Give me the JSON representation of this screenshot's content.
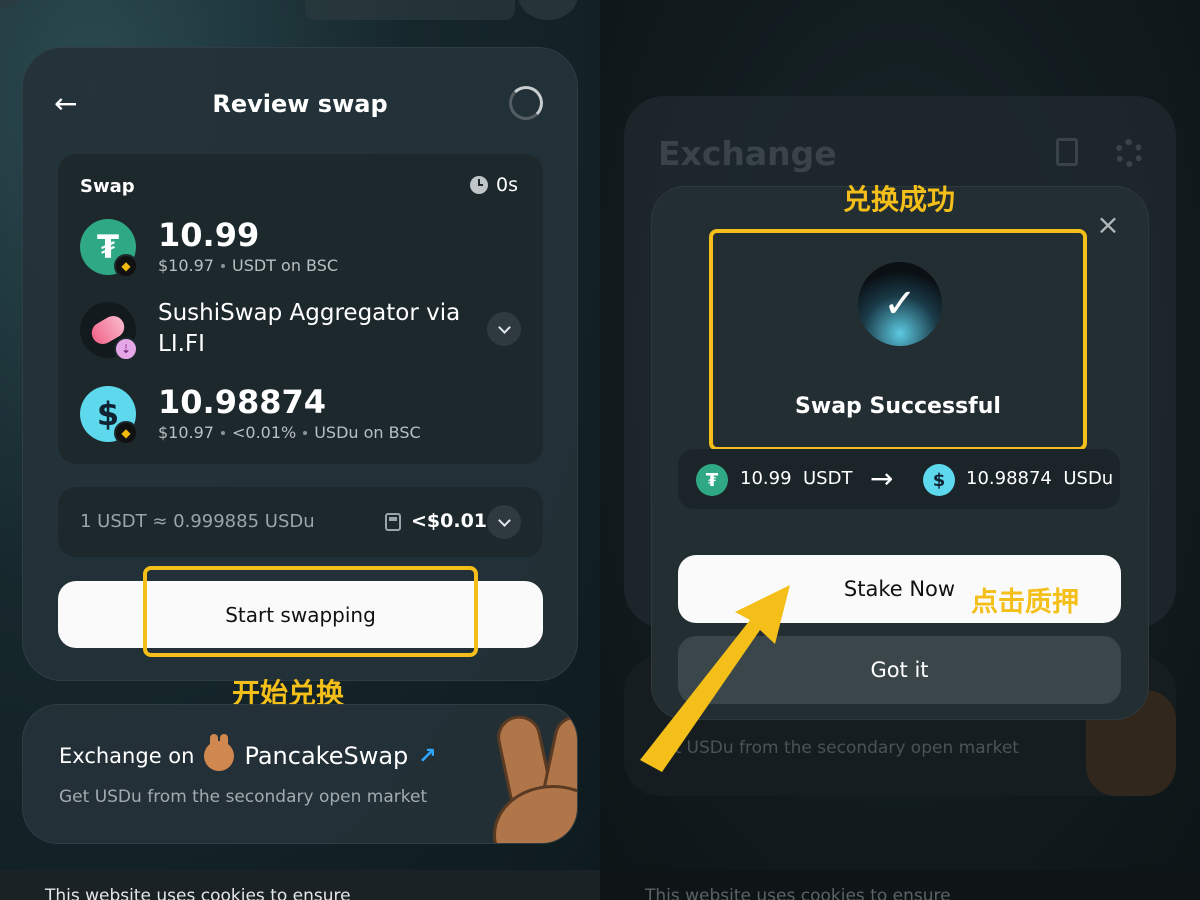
{
  "left_panel": {
    "header": {
      "title": "Review swap"
    },
    "swap_box": {
      "label": "Swap",
      "timer": "0s",
      "from": {
        "amount": "10.99",
        "usd_value": "$10.97",
        "asset": "USDT on BSC",
        "icon": "usdt-icon"
      },
      "route": {
        "name": "SushiSwap Aggregator via LI.FI",
        "icon": "sushiswap-icon"
      },
      "to": {
        "amount": "10.98874",
        "usd_value": "$10.97",
        "price_impact": "<0.01%",
        "asset": "USDu on BSC",
        "icon": "usdu-icon"
      }
    },
    "rate_box": {
      "rate": "1 USDT ≈ 0.999885 USDu",
      "gas": "<$0.01"
    },
    "start_button": "Start swapping",
    "annotation_start": "开始兑换",
    "pancake_card": {
      "title_prefix": "Exchange on",
      "brand": "PancakeSwap",
      "subtitle": "Get USDu from the secondary open market"
    },
    "cookie_text": "This website uses cookies to ensure"
  },
  "right_panel": {
    "background": {
      "title": "Exchange",
      "ghost_subtitle": "et USDu from the secondary open market",
      "cookie_text": "This website uses cookies to ensure"
    },
    "annotation_success": "兑换成功",
    "modal": {
      "status": "Swap Successful",
      "from_amount": "10.99",
      "from_symbol": "USDT",
      "to_amount": "10.98874",
      "to_symbol": "USDu",
      "stake_button": "Stake Now",
      "got_it_button": "Got it"
    },
    "annotation_stake": "点击质押"
  },
  "colors": {
    "highlight": "#f5bf19",
    "usdt": "#2fa885",
    "usdu": "#5ed8ec",
    "card": "#243238"
  }
}
